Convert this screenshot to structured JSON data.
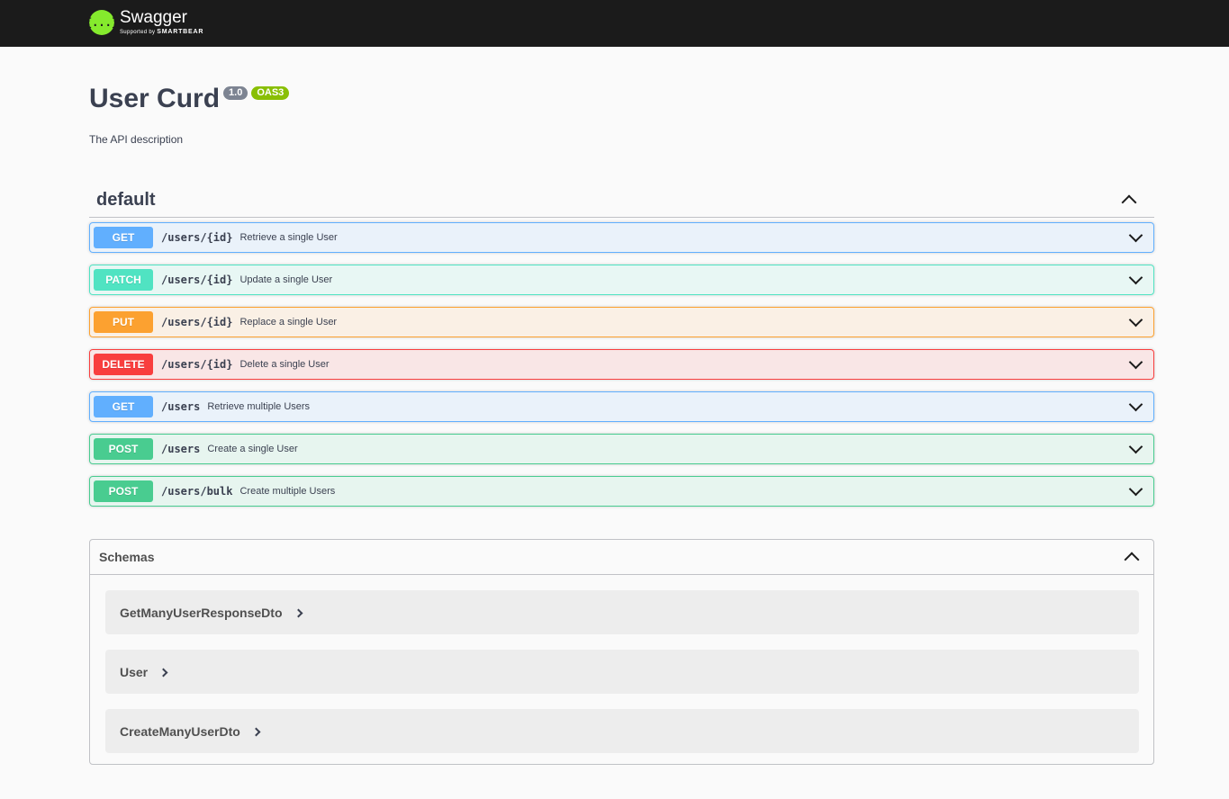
{
  "topbar": {
    "brand_name": "Swagger",
    "brand_sub_prefix": "Supported by",
    "brand_sub_company": "SMARTBEAR",
    "logo_glyph": "{...}"
  },
  "info": {
    "title": "User Curd",
    "version": "1.0",
    "oas_badge": "OAS3",
    "description": "The API description"
  },
  "tag": {
    "name": "default",
    "expanded": true
  },
  "operations": [
    {
      "method": "GET",
      "path": "/users/{id}",
      "summary": "Retrieve a single User"
    },
    {
      "method": "PATCH",
      "path": "/users/{id}",
      "summary": "Update a single User"
    },
    {
      "method": "PUT",
      "path": "/users/{id}",
      "summary": "Replace a single User"
    },
    {
      "method": "DELETE",
      "path": "/users/{id}",
      "summary": "Delete a single User"
    },
    {
      "method": "GET",
      "path": "/users",
      "summary": "Retrieve multiple Users"
    },
    {
      "method": "POST",
      "path": "/users",
      "summary": "Create a single User"
    },
    {
      "method": "POST",
      "path": "/users/bulk",
      "summary": "Create multiple Users"
    }
  ],
  "schemas": {
    "title": "Schemas",
    "expanded": true,
    "items": [
      {
        "name": "GetManyUserResponseDto"
      },
      {
        "name": "User"
      },
      {
        "name": "CreateManyUserDto"
      }
    ]
  },
  "colors": {
    "get": "#61affe",
    "patch": "#50e3c2",
    "put": "#fca130",
    "delete": "#f93e3e",
    "post": "#49cc90",
    "brand_green": "#85ea2d",
    "topbar_bg": "#1b1b1b"
  }
}
